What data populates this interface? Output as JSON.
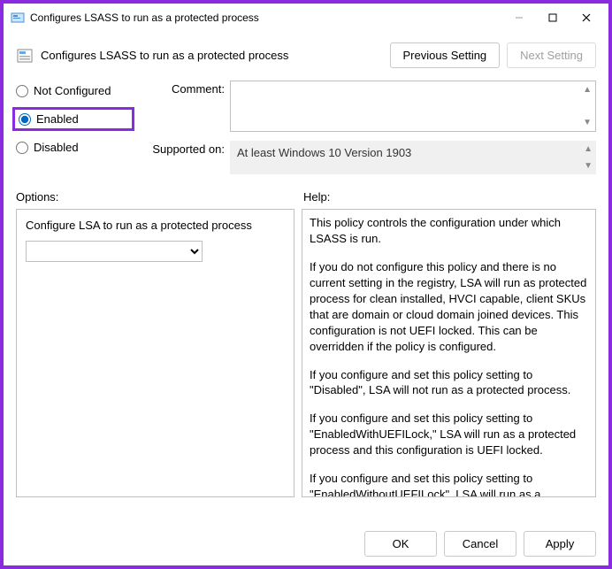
{
  "window": {
    "title": "Configures LSASS to run as a protected process"
  },
  "header": {
    "title": "Configures LSASS to run as a protected process",
    "prev_btn": "Previous Setting",
    "next_btn": "Next Setting"
  },
  "state": {
    "not_configured": "Not Configured",
    "enabled": "Enabled",
    "disabled": "Disabled",
    "selected": "enabled"
  },
  "fields": {
    "comment_label": "Comment:",
    "comment_value": "",
    "supported_label": "Supported on:",
    "supported_value": "At least Windows 10 Version 1903"
  },
  "panels": {
    "options_label": "Options:",
    "help_label": "Help:"
  },
  "options": {
    "dropdown_label": "Configure LSA to run as a protected process",
    "dropdown_value": ""
  },
  "help": {
    "p1": "This policy controls the configuration under which LSASS is run.",
    "p2": "If you do not configure this policy and there is no current setting in the registry, LSA will run as protected process for clean installed, HVCI capable, client SKUs that are domain or cloud domain joined devices. This configuration is not UEFI locked. This can be overridden if the policy is configured.",
    "p3": "If you configure and set this policy setting to \"Disabled\", LSA will not run as a protected process.",
    "p4": "If you configure and set this policy setting to \"EnabledWithUEFILock,\" LSA will run as a protected process and this configuration is UEFI locked.",
    "p5": "If you configure and set this policy setting to \"EnabledWithoutUEFILock\", LSA will run as a protected process and this configuration is not UEFI locked."
  },
  "footer": {
    "ok": "OK",
    "cancel": "Cancel",
    "apply": "Apply"
  }
}
